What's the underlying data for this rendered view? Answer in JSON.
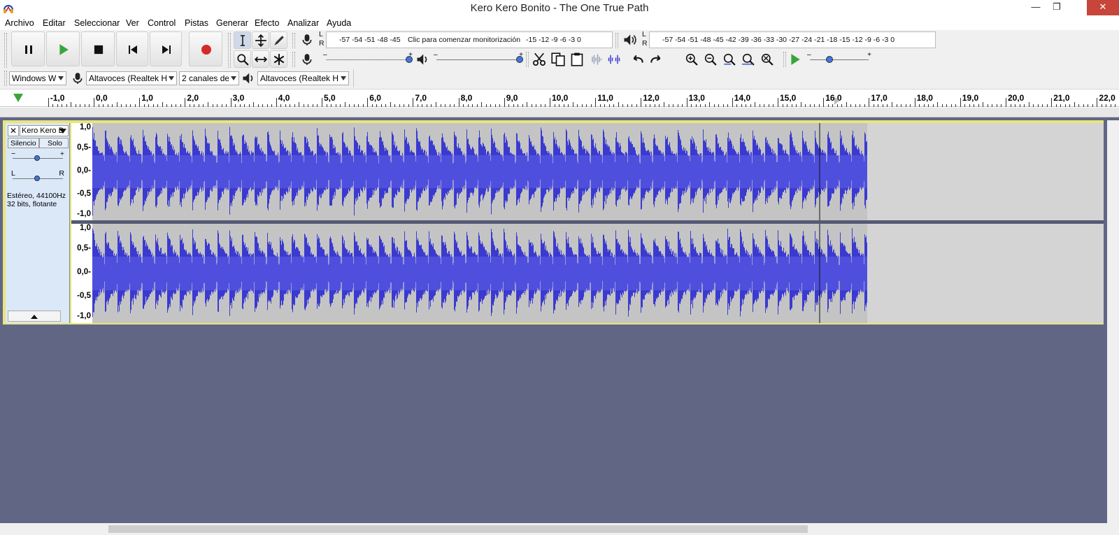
{
  "window": {
    "title": "Kero Kero Bonito - The One True Path",
    "minimize": "—",
    "maximize": "❐",
    "close": "✕"
  },
  "menu": [
    "Archivo",
    "Editar",
    "Seleccionar",
    "Ver",
    "Control",
    "Pistas",
    "Generar",
    "Efecto",
    "Analizar",
    "Ayuda"
  ],
  "transport": {
    "pause": "pause-icon",
    "play": "play-icon",
    "stop": "stop-icon",
    "skip_start": "skip-start-icon",
    "skip_end": "skip-end-icon",
    "record": "record-icon",
    "record_color": "#d62a2a",
    "play_color": "#3aa53a"
  },
  "record_meter": {
    "l_label": "L",
    "r_label": "R",
    "scale": "-57 -54 -51 -48 -45",
    "monitor_text": "Clic para comenzar monitorización",
    "scale_right": "-15 -12 -9 -6 -3 0"
  },
  "play_meter": {
    "l_label": "L",
    "r_label": "R",
    "scale": "-57 -54 -51 -48 -45 -42 -39 -36 -33 -30 -27 -24 -21 -18 -15 -12 -9 -6 -3 0"
  },
  "device_toolbar": {
    "host": "Windows W",
    "record_device": "Altavoces (Realtek H",
    "channels": "2 canales de",
    "playback_device": "Altavoces (Realtek H"
  },
  "ruler": {
    "ticks": [
      "-1,0",
      "0,0",
      "1,0",
      "2,0",
      "3,0",
      "4,0",
      "5,0",
      "6,0",
      "7,0",
      "8,0",
      "9,0",
      "10,0",
      "11,0",
      "12,0",
      "13,0",
      "14,0",
      "15,0",
      "16,0",
      "17,0",
      "18,0",
      "19,0",
      "20,0",
      "21,0",
      "22,0"
    ]
  },
  "track": {
    "name": "Kero Kero B",
    "mute_label": "Silencio",
    "solo_label": "Solo",
    "gain_minus": "−",
    "gain_plus": "+",
    "pan_left": "L",
    "pan_right": "R",
    "info_line1": "Estéreo, 44100Hz",
    "info_line2": "32 bits, flotante",
    "scale_labels": [
      "1,0",
      "0,5-",
      "0,0-",
      "-0,5",
      "-1,0"
    ],
    "wave_color": "#3a3ad0",
    "bg_color": "#626685"
  }
}
